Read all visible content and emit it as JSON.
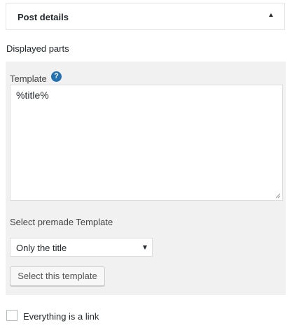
{
  "panel": {
    "title": "Post details",
    "toggle_icon": "caret-up-icon"
  },
  "displayed_parts": {
    "label": "Displayed parts"
  },
  "template": {
    "label": "Template",
    "help_icon": "help-icon",
    "help_glyph": "?",
    "value": "%title%"
  },
  "premade": {
    "label": "Select premade Template",
    "selected": "Only the title",
    "button_label": "Select this template"
  },
  "link_option": {
    "label": "Everything is a link",
    "checked": false
  },
  "colors": {
    "help_icon": "#2271b1",
    "panel_background": "#f1f1f1",
    "text": "#23282d"
  }
}
